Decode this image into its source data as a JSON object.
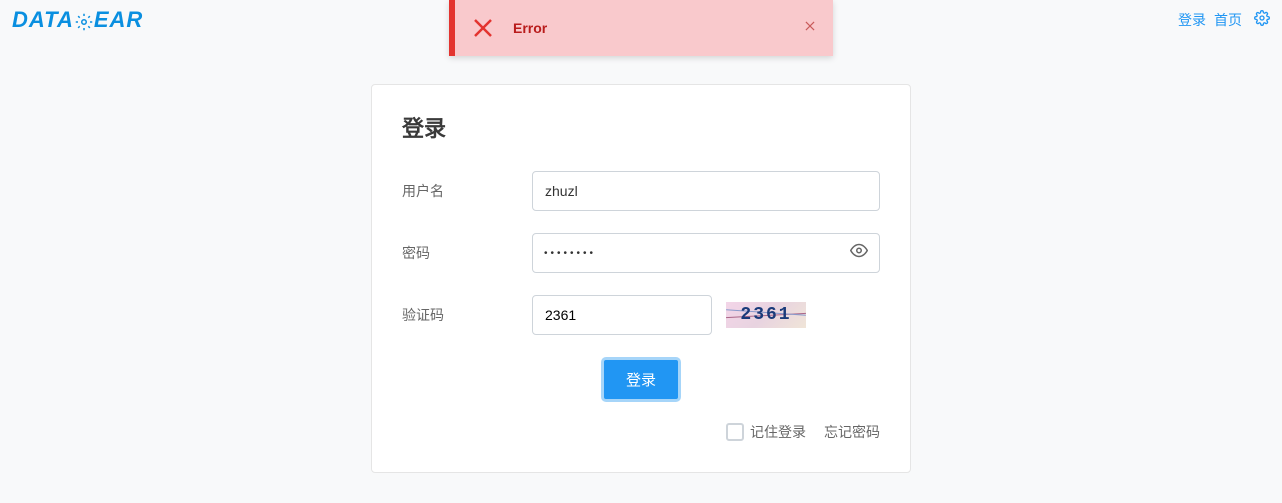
{
  "header": {
    "logo_text_1": "DATA",
    "logo_text_2": "EAR",
    "links": {
      "login": "登录",
      "home": "首页"
    }
  },
  "toast": {
    "message": "Error"
  },
  "login": {
    "title": "登录",
    "username_label": "用户名",
    "username_value": "zhuzl",
    "password_label": "密码",
    "password_mask": "••••••••",
    "captcha_label": "验证码",
    "captcha_value": "2361",
    "captcha_image_text": "2361",
    "submit_label": "登录",
    "remember_label": "记住登录",
    "forgot_label": "忘记密码"
  }
}
